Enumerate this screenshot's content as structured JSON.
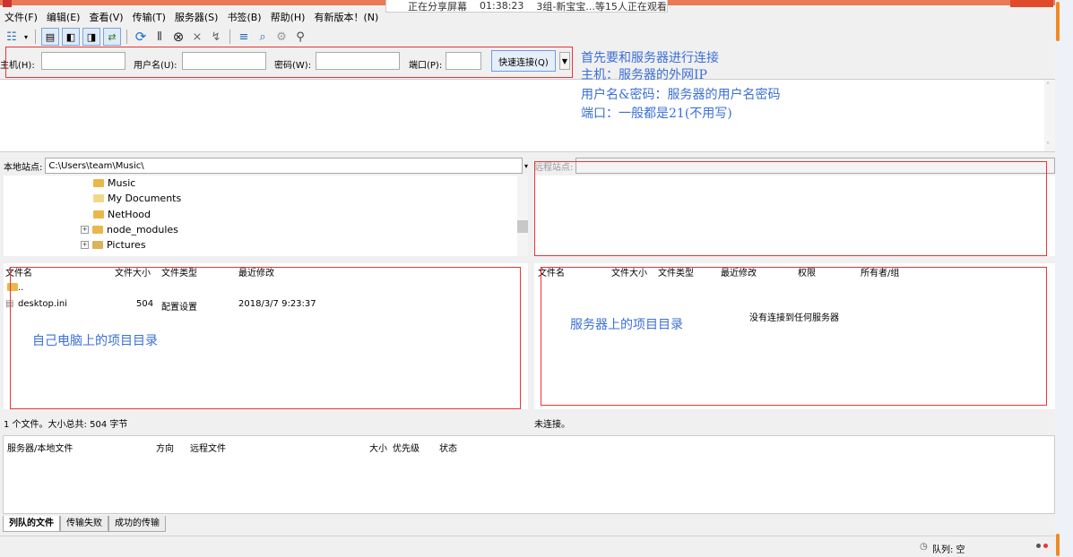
{
  "banner": {
    "status": "正在分享屏幕",
    "time": "01:38:23",
    "viewers": "3组-新宝宝...等15人正在观看"
  },
  "menu": [
    "文件(F)",
    "编辑(E)",
    "查看(V)",
    "传输(T)",
    "服务器(S)",
    "书签(B)",
    "帮助(H)",
    "有新版本！(N)"
  ],
  "quickconnect": {
    "host_label": "主机(H):",
    "user_label": "用户名(U):",
    "pass_label": "密码(W):",
    "port_label": "端口(P):",
    "button": "快速连接(Q)",
    "host_value": "",
    "user_value": "",
    "pass_value": "",
    "port_value": ""
  },
  "annotations": {
    "connect": "首先要和服务器进行连接",
    "host": "主机：服务器的外网IP",
    "userpass": "用户名&密码：服务器的用户名密码",
    "port": "端口：一般都是21(不用写)",
    "local": "自己电脑上的项目目录",
    "remote": "服务器上的项目目录"
  },
  "local": {
    "site_label": "本地站点:",
    "path": "C:\\Users\\team\\Music\\",
    "tree": [
      "Music",
      "My Documents",
      "NetHood",
      "node_modules",
      "Pictures"
    ],
    "columns": [
      "文件名",
      "文件大小",
      "文件类型",
      "最近修改"
    ],
    "rows": [
      {
        "name": "..",
        "size": "",
        "type": "",
        "modified": ""
      },
      {
        "name": "desktop.ini",
        "size": "504",
        "type": "配置设置",
        "modified": "2018/3/7 9:23:37"
      }
    ],
    "status": "1 个文件。大小总共: 504 字节"
  },
  "remote": {
    "site_label": "远程站点:",
    "columns": [
      "文件名",
      "文件大小",
      "文件类型",
      "最近修改",
      "权限",
      "所有者/组"
    ],
    "empty": "没有连接到任何服务器",
    "status": "未连接。"
  },
  "queue": {
    "columns": [
      "服务器/本地文件",
      "方向",
      "远程文件",
      "大小",
      "优先级",
      "状态"
    ],
    "tabs": [
      "列队的文件",
      "传输失败",
      "成功的传输"
    ]
  },
  "statusbar": {
    "queue": "队列: 空"
  },
  "colors": {
    "accent": "#3b6fd6",
    "highlight": "#e33333"
  }
}
